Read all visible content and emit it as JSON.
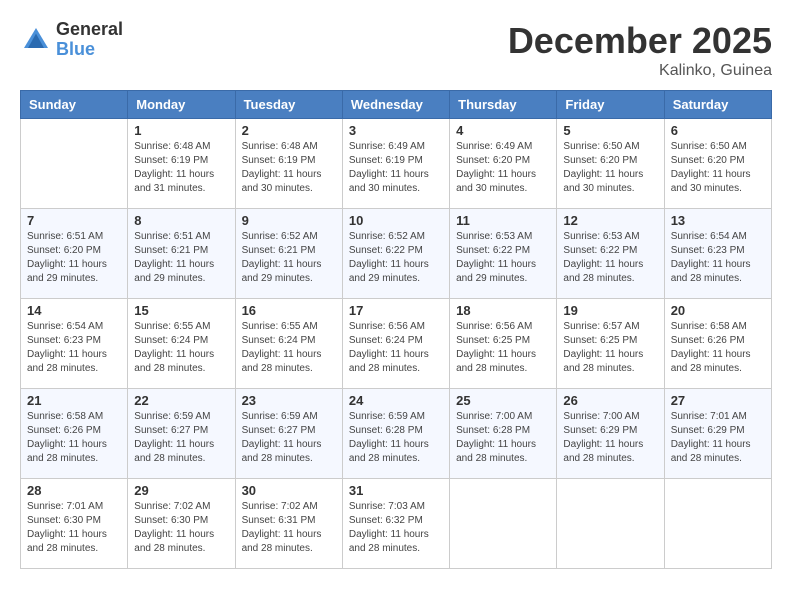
{
  "logo": {
    "general": "General",
    "blue": "Blue"
  },
  "title": "December 2025",
  "location": "Kalinko, Guinea",
  "days_of_week": [
    "Sunday",
    "Monday",
    "Tuesday",
    "Wednesday",
    "Thursday",
    "Friday",
    "Saturday"
  ],
  "weeks": [
    [
      {
        "day": "",
        "sunrise": "",
        "sunset": "",
        "daylight": ""
      },
      {
        "day": "1",
        "sunrise": "Sunrise: 6:48 AM",
        "sunset": "Sunset: 6:19 PM",
        "daylight": "Daylight: 11 hours and 31 minutes."
      },
      {
        "day": "2",
        "sunrise": "Sunrise: 6:48 AM",
        "sunset": "Sunset: 6:19 PM",
        "daylight": "Daylight: 11 hours and 30 minutes."
      },
      {
        "day": "3",
        "sunrise": "Sunrise: 6:49 AM",
        "sunset": "Sunset: 6:19 PM",
        "daylight": "Daylight: 11 hours and 30 minutes."
      },
      {
        "day": "4",
        "sunrise": "Sunrise: 6:49 AM",
        "sunset": "Sunset: 6:20 PM",
        "daylight": "Daylight: 11 hours and 30 minutes."
      },
      {
        "day": "5",
        "sunrise": "Sunrise: 6:50 AM",
        "sunset": "Sunset: 6:20 PM",
        "daylight": "Daylight: 11 hours and 30 minutes."
      },
      {
        "day": "6",
        "sunrise": "Sunrise: 6:50 AM",
        "sunset": "Sunset: 6:20 PM",
        "daylight": "Daylight: 11 hours and 30 minutes."
      }
    ],
    [
      {
        "day": "7",
        "sunrise": "Sunrise: 6:51 AM",
        "sunset": "Sunset: 6:20 PM",
        "daylight": "Daylight: 11 hours and 29 minutes."
      },
      {
        "day": "8",
        "sunrise": "Sunrise: 6:51 AM",
        "sunset": "Sunset: 6:21 PM",
        "daylight": "Daylight: 11 hours and 29 minutes."
      },
      {
        "day": "9",
        "sunrise": "Sunrise: 6:52 AM",
        "sunset": "Sunset: 6:21 PM",
        "daylight": "Daylight: 11 hours and 29 minutes."
      },
      {
        "day": "10",
        "sunrise": "Sunrise: 6:52 AM",
        "sunset": "Sunset: 6:22 PM",
        "daylight": "Daylight: 11 hours and 29 minutes."
      },
      {
        "day": "11",
        "sunrise": "Sunrise: 6:53 AM",
        "sunset": "Sunset: 6:22 PM",
        "daylight": "Daylight: 11 hours and 29 minutes."
      },
      {
        "day": "12",
        "sunrise": "Sunrise: 6:53 AM",
        "sunset": "Sunset: 6:22 PM",
        "daylight": "Daylight: 11 hours and 28 minutes."
      },
      {
        "day": "13",
        "sunrise": "Sunrise: 6:54 AM",
        "sunset": "Sunset: 6:23 PM",
        "daylight": "Daylight: 11 hours and 28 minutes."
      }
    ],
    [
      {
        "day": "14",
        "sunrise": "Sunrise: 6:54 AM",
        "sunset": "Sunset: 6:23 PM",
        "daylight": "Daylight: 11 hours and 28 minutes."
      },
      {
        "day": "15",
        "sunrise": "Sunrise: 6:55 AM",
        "sunset": "Sunset: 6:24 PM",
        "daylight": "Daylight: 11 hours and 28 minutes."
      },
      {
        "day": "16",
        "sunrise": "Sunrise: 6:55 AM",
        "sunset": "Sunset: 6:24 PM",
        "daylight": "Daylight: 11 hours and 28 minutes."
      },
      {
        "day": "17",
        "sunrise": "Sunrise: 6:56 AM",
        "sunset": "Sunset: 6:24 PM",
        "daylight": "Daylight: 11 hours and 28 minutes."
      },
      {
        "day": "18",
        "sunrise": "Sunrise: 6:56 AM",
        "sunset": "Sunset: 6:25 PM",
        "daylight": "Daylight: 11 hours and 28 minutes."
      },
      {
        "day": "19",
        "sunrise": "Sunrise: 6:57 AM",
        "sunset": "Sunset: 6:25 PM",
        "daylight": "Daylight: 11 hours and 28 minutes."
      },
      {
        "day": "20",
        "sunrise": "Sunrise: 6:58 AM",
        "sunset": "Sunset: 6:26 PM",
        "daylight": "Daylight: 11 hours and 28 minutes."
      }
    ],
    [
      {
        "day": "21",
        "sunrise": "Sunrise: 6:58 AM",
        "sunset": "Sunset: 6:26 PM",
        "daylight": "Daylight: 11 hours and 28 minutes."
      },
      {
        "day": "22",
        "sunrise": "Sunrise: 6:59 AM",
        "sunset": "Sunset: 6:27 PM",
        "daylight": "Daylight: 11 hours and 28 minutes."
      },
      {
        "day": "23",
        "sunrise": "Sunrise: 6:59 AM",
        "sunset": "Sunset: 6:27 PM",
        "daylight": "Daylight: 11 hours and 28 minutes."
      },
      {
        "day": "24",
        "sunrise": "Sunrise: 6:59 AM",
        "sunset": "Sunset: 6:28 PM",
        "daylight": "Daylight: 11 hours and 28 minutes."
      },
      {
        "day": "25",
        "sunrise": "Sunrise: 7:00 AM",
        "sunset": "Sunset: 6:28 PM",
        "daylight": "Daylight: 11 hours and 28 minutes."
      },
      {
        "day": "26",
        "sunrise": "Sunrise: 7:00 AM",
        "sunset": "Sunset: 6:29 PM",
        "daylight": "Daylight: 11 hours and 28 minutes."
      },
      {
        "day": "27",
        "sunrise": "Sunrise: 7:01 AM",
        "sunset": "Sunset: 6:29 PM",
        "daylight": "Daylight: 11 hours and 28 minutes."
      }
    ],
    [
      {
        "day": "28",
        "sunrise": "Sunrise: 7:01 AM",
        "sunset": "Sunset: 6:30 PM",
        "daylight": "Daylight: 11 hours and 28 minutes."
      },
      {
        "day": "29",
        "sunrise": "Sunrise: 7:02 AM",
        "sunset": "Sunset: 6:30 PM",
        "daylight": "Daylight: 11 hours and 28 minutes."
      },
      {
        "day": "30",
        "sunrise": "Sunrise: 7:02 AM",
        "sunset": "Sunset: 6:31 PM",
        "daylight": "Daylight: 11 hours and 28 minutes."
      },
      {
        "day": "31",
        "sunrise": "Sunrise: 7:03 AM",
        "sunset": "Sunset: 6:32 PM",
        "daylight": "Daylight: 11 hours and 28 minutes."
      },
      {
        "day": "",
        "sunrise": "",
        "sunset": "",
        "daylight": ""
      },
      {
        "day": "",
        "sunrise": "",
        "sunset": "",
        "daylight": ""
      },
      {
        "day": "",
        "sunrise": "",
        "sunset": "",
        "daylight": ""
      }
    ]
  ]
}
